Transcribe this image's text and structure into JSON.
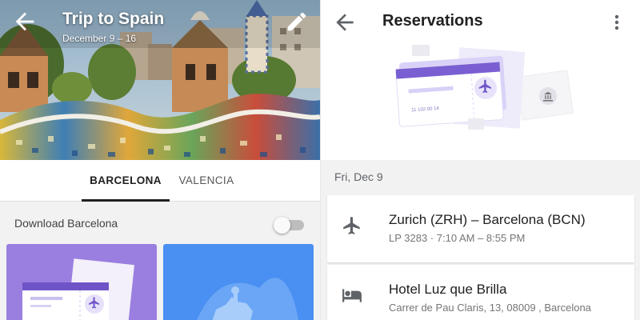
{
  "trip": {
    "title": "Trip to Spain",
    "dates": "December 9 – 16"
  },
  "tabs": [
    {
      "label": "BARCELONA",
      "active": true
    },
    {
      "label": "VALENCIA",
      "active": false
    }
  ],
  "download": {
    "label": "Download Barcelona",
    "enabled": false
  },
  "reservations": {
    "title": "Reservations",
    "date_heading": "Fri, Dec 9",
    "items": [
      {
        "icon": "flight-icon",
        "title": "Zurich (ZRH) – Barcelona (BCN)",
        "subtitle": "LP 3283 · 7:10 AM – 8:55 PM"
      },
      {
        "icon": "hotel-bed-icon",
        "title": "Hotel Luz que Brilla",
        "subtitle": "Carrer de Pau Claris, 13, 08009 , Barcelona"
      }
    ]
  },
  "colors": {
    "accent_purple": "#9a7fe0",
    "accent_blue": "#4a8ff2",
    "ticket_purple": "#8a6fdc"
  }
}
